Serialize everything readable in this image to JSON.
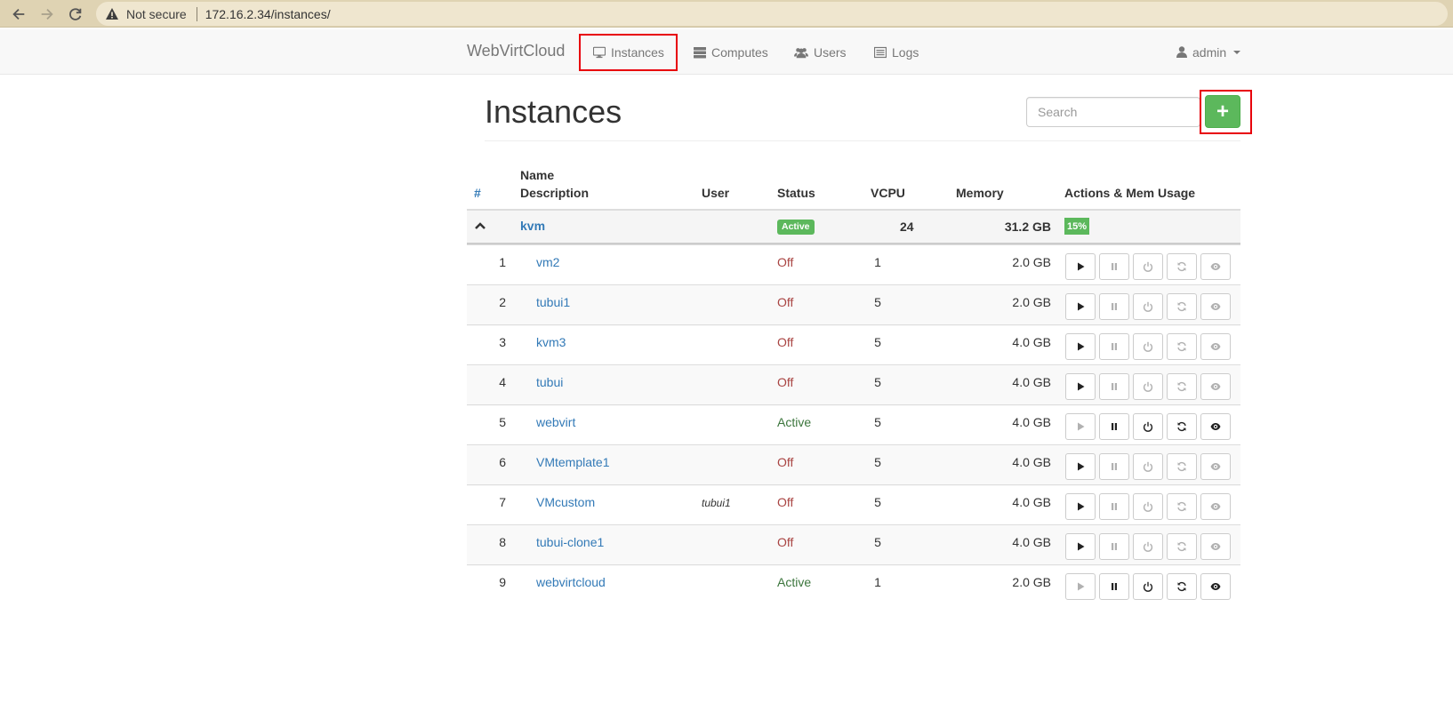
{
  "browser": {
    "security_label": "Not secure",
    "url": "172.16.2.34/instances/"
  },
  "navbar": {
    "brand": "WebVirtCloud",
    "items": [
      {
        "label": "Instances",
        "icon": "desktop-icon",
        "active": true
      },
      {
        "label": "Computes",
        "icon": "server-icon"
      },
      {
        "label": "Users",
        "icon": "users-icon"
      },
      {
        "label": "Logs",
        "icon": "list-icon"
      }
    ],
    "user": "admin"
  },
  "page": {
    "title": "Instances",
    "search_placeholder": "Search",
    "add_label": "+"
  },
  "table": {
    "headers": {
      "hash": "#",
      "name": "Name",
      "description": "Description",
      "user": "User",
      "status": "Status",
      "vcpu": "VCPU",
      "memory": "Memory",
      "actions": "Actions & Mem Usage"
    },
    "group": {
      "host": "kvm",
      "status": "Active",
      "vcpu": "24",
      "memory": "31.2 GB",
      "mem_usage": "15%"
    },
    "rows": [
      {
        "num": "1",
        "name": "vm2",
        "user": "",
        "status": "Off",
        "vcpu": "1",
        "memory": "2.0 GB"
      },
      {
        "num": "2",
        "name": "tubui1",
        "user": "",
        "status": "Off",
        "vcpu": "5",
        "memory": "2.0 GB"
      },
      {
        "num": "3",
        "name": "kvm3",
        "user": "",
        "status": "Off",
        "vcpu": "5",
        "memory": "4.0 GB"
      },
      {
        "num": "4",
        "name": "tubui",
        "user": "",
        "status": "Off",
        "vcpu": "5",
        "memory": "4.0 GB"
      },
      {
        "num": "5",
        "name": "webvirt",
        "user": "",
        "status": "Active",
        "vcpu": "5",
        "memory": "4.0 GB"
      },
      {
        "num": "6",
        "name": "VMtemplate1",
        "user": "",
        "status": "Off",
        "vcpu": "5",
        "memory": "4.0 GB"
      },
      {
        "num": "7",
        "name": "VMcustom",
        "user": "tubui1",
        "status": "Off",
        "vcpu": "5",
        "memory": "4.0 GB"
      },
      {
        "num": "8",
        "name": "tubui-clone1",
        "user": "",
        "status": "Off",
        "vcpu": "5",
        "memory": "4.0 GB"
      },
      {
        "num": "9",
        "name": "webvirtcloud",
        "user": "",
        "status": "Active",
        "vcpu": "1",
        "memory": "2.0 GB"
      }
    ],
    "action_icons": [
      "play-icon",
      "pause-icon",
      "power-icon",
      "refresh-icon",
      "eye-icon"
    ]
  },
  "colors": {
    "link": "#337ab7",
    "success": "#5cb85c",
    "off": "#a94442",
    "active": "#3c763d",
    "highlight": "#e8000b"
  }
}
